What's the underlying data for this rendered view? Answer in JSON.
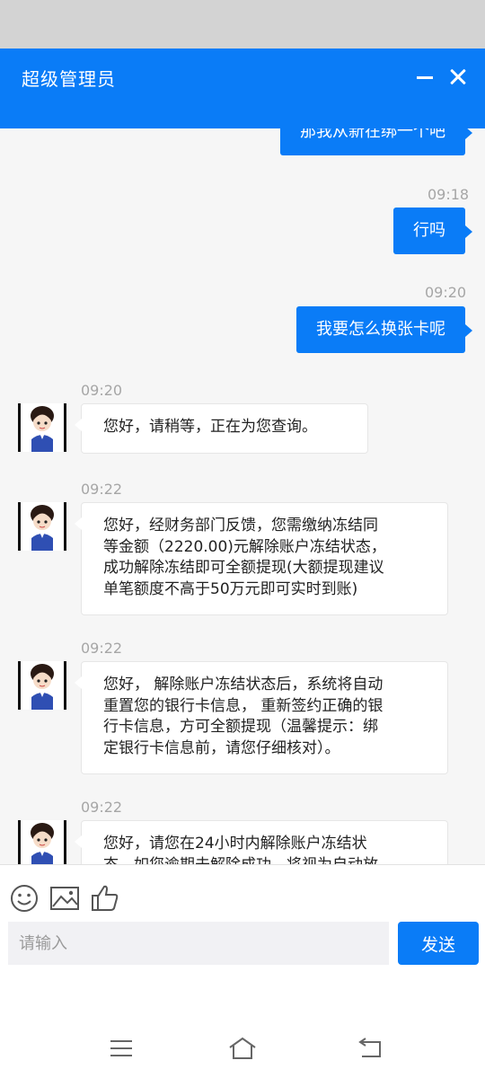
{
  "header": {
    "title": "超级管理员"
  },
  "messages": [
    {
      "dir": "out",
      "text": "那我从新在绑一个吧"
    },
    {
      "dir": "out",
      "time": "09:18",
      "text": "行吗"
    },
    {
      "dir": "out",
      "time": "09:20",
      "text": "我要怎么换张卡呢"
    },
    {
      "dir": "in",
      "time": "09:20",
      "lines": [
        "您好，请稍等，正在为您查询。"
      ]
    },
    {
      "dir": "in",
      "time": "09:22",
      "lines": [
        "您好，经财务部门反馈，您需缴纳冻结同",
        "等金额（2220.00)元解除账户冻结状态，",
        "成功解除冻结即可全额提现(大额提现建议",
        "单笔额度不高于50万元即可实时到账)"
      ]
    },
    {
      "dir": "in",
      "time": "09:22",
      "lines": [
        "您好， 解除账户冻结状态后，系统将自动",
        "重置您的银行卡信息， 重新签约正确的银",
        "行卡信息，方可全额提现（温馨提示：绑",
        "定银行卡信息前，请您仔细核对）。"
      ]
    },
    {
      "dir": "in",
      "time": "09:22",
      "lines": [
        "您好，请您在24小时内解除账户冻结状",
        "态，如您逾期未解除成功，将视为自动放"
      ]
    }
  ],
  "input": {
    "placeholder": "请输入",
    "value": ""
  },
  "send_button": {
    "label": "发送"
  },
  "toolbar": {
    "icons": [
      "emoji-icon",
      "image-icon",
      "thumbs-up-icon"
    ]
  },
  "navbar": {
    "icons": [
      "menu-icon",
      "home-icon",
      "back-icon"
    ]
  },
  "colors": {
    "accent": "#0a7cf7",
    "status_bar": "#d3d3d3",
    "chat_bg": "#f6f6f6"
  }
}
